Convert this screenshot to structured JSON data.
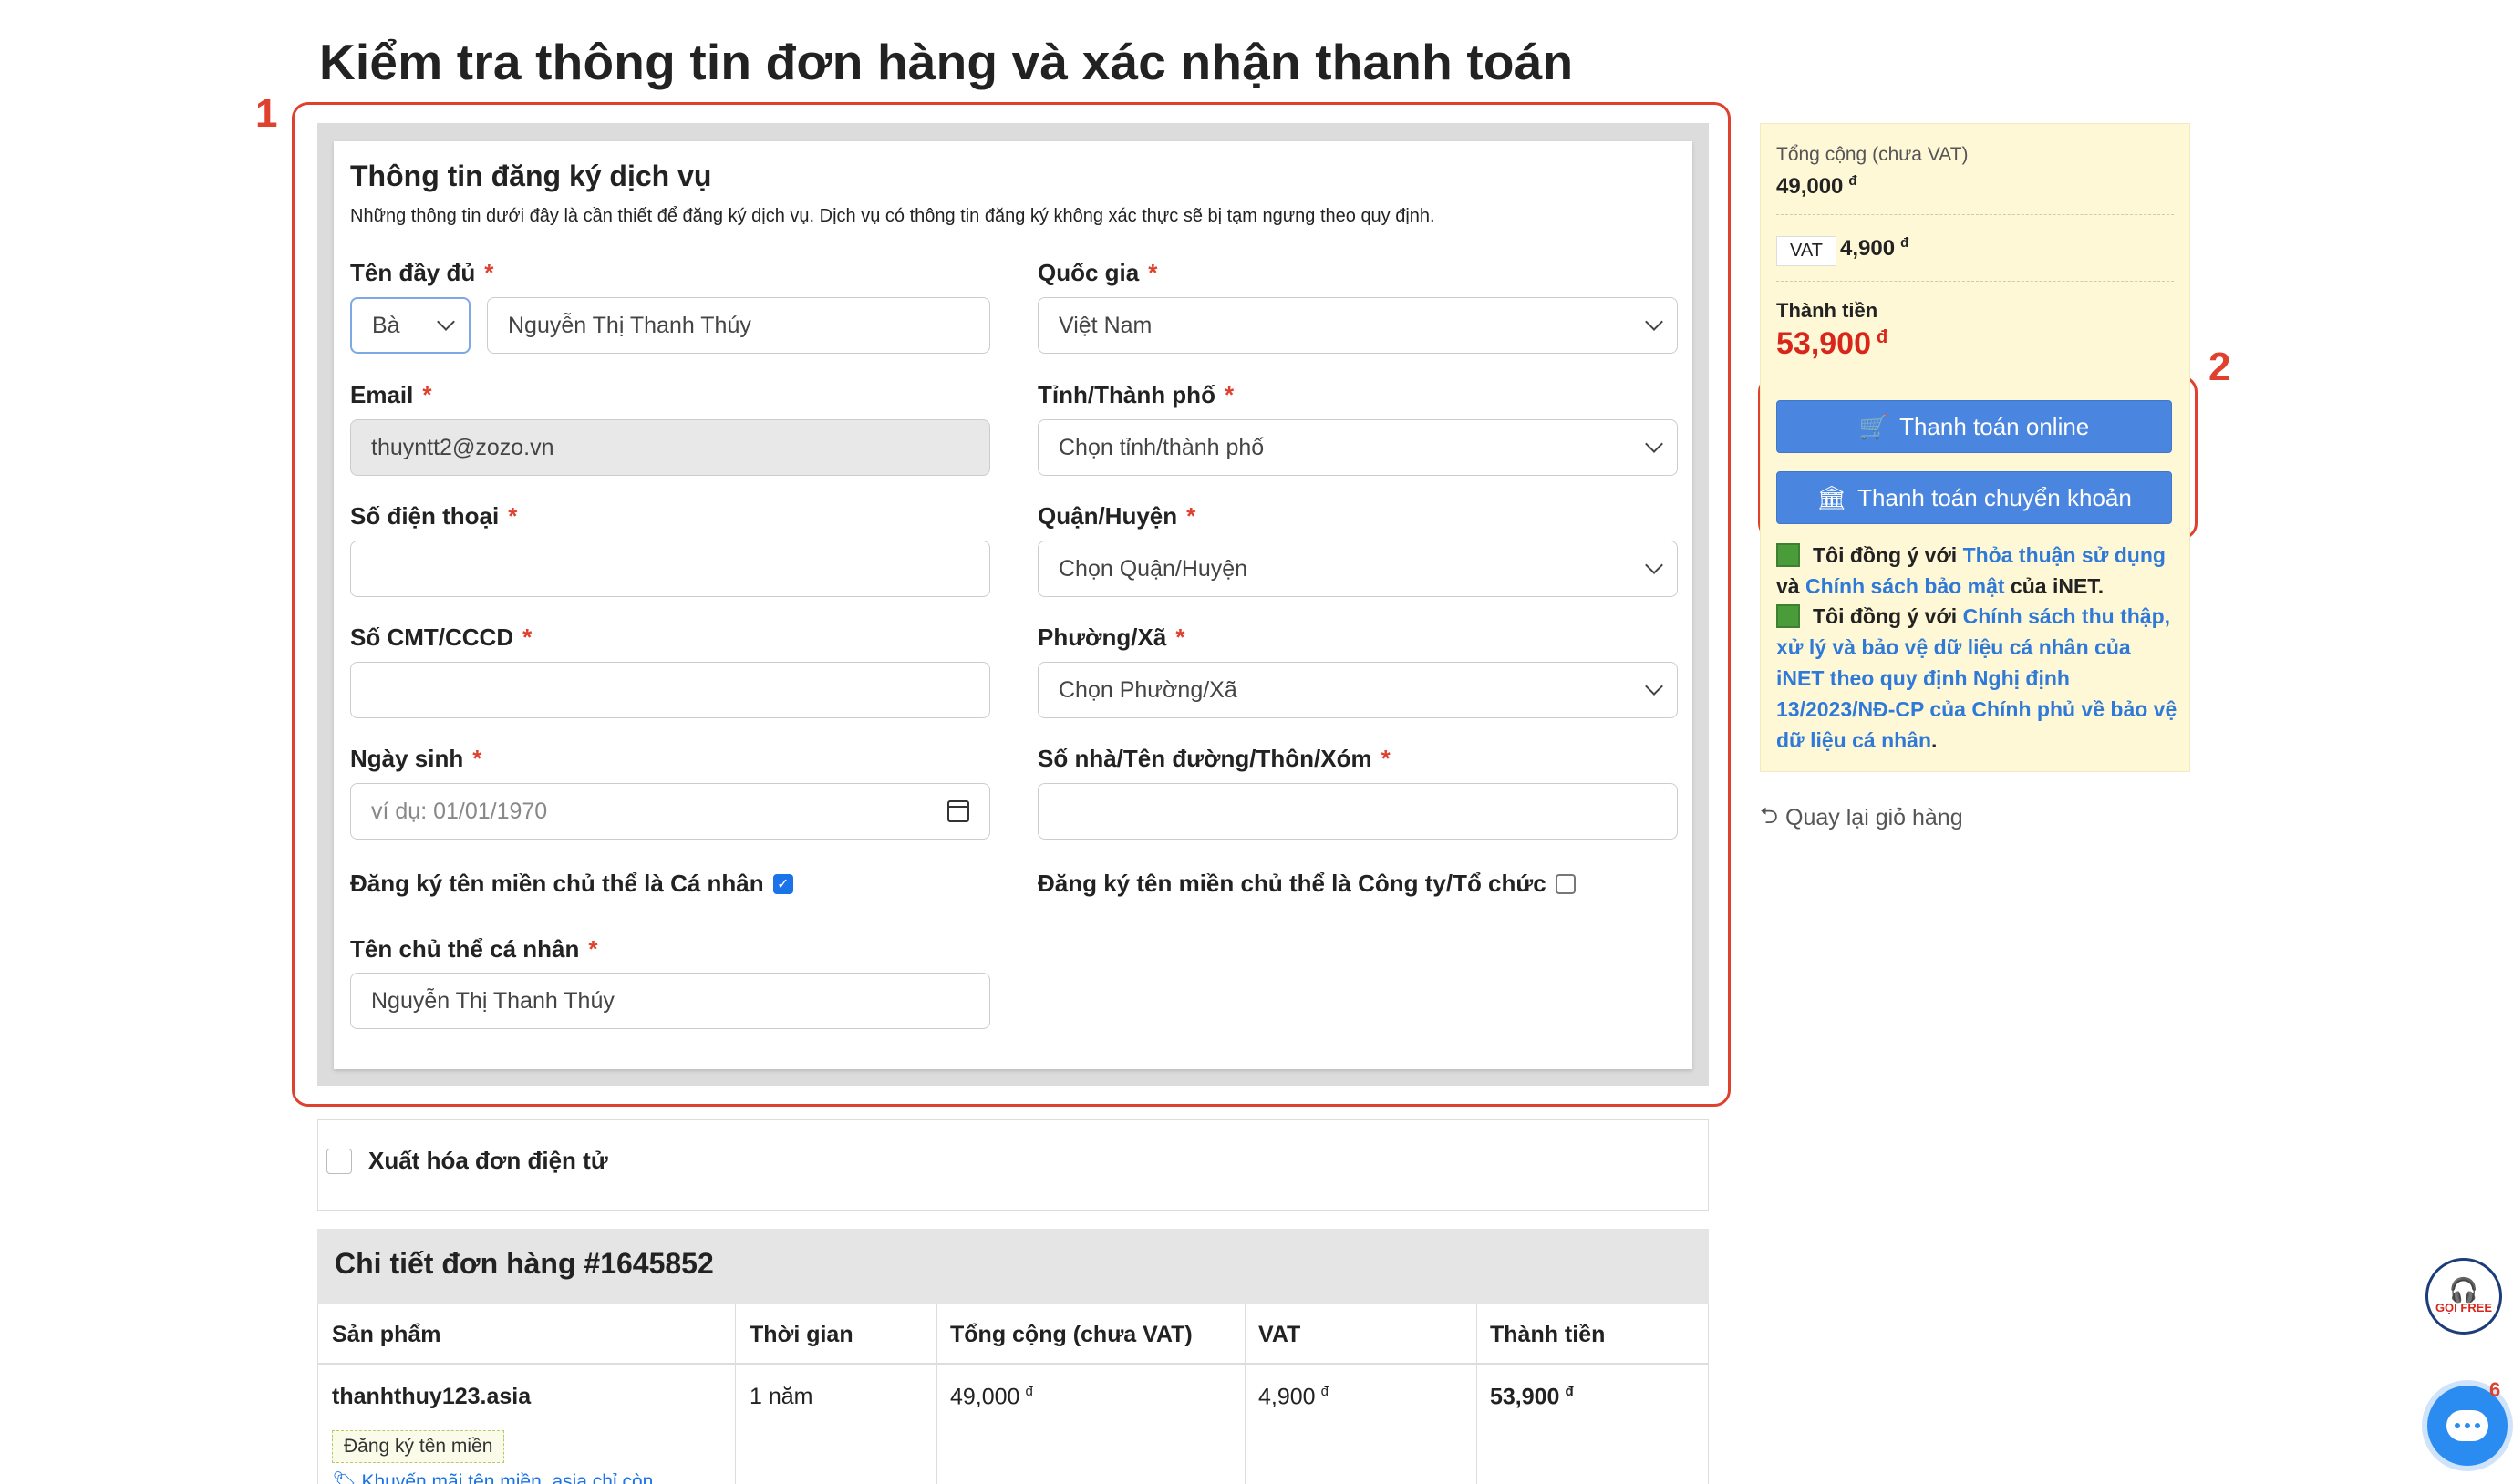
{
  "page_title": "Kiểm tra thông tin đơn hàng và xác nhận thanh toán",
  "steps": {
    "one": "1",
    "two": "2"
  },
  "registration": {
    "title": "Thông tin đăng ký dịch vụ",
    "description": "Những thông tin dưới đây là cần thiết để đăng ký dịch vụ. Dịch vụ có thông tin đăng ký không xác thực sẽ bị tạm ngưng theo quy định.",
    "required_mark": "*",
    "full_name": {
      "label": "Tên đầy đủ",
      "salutation": "Bà",
      "value": "Nguyễn Thị Thanh Thúy"
    },
    "country": {
      "label": "Quốc gia",
      "value": "Việt Nam"
    },
    "email": {
      "label": "Email",
      "value": "thuyntt2@zozo.vn"
    },
    "province": {
      "label": "Tỉnh/Thành phố",
      "value": "Chọn tỉnh/thành phố"
    },
    "phone": {
      "label": "Số điện thoại",
      "value": ""
    },
    "district": {
      "label": "Quận/Huyện",
      "value": "Chọn Quận/Huyện"
    },
    "id_number": {
      "label": "Số CMT/CCCD",
      "value": ""
    },
    "ward": {
      "label": "Phường/Xã",
      "value": "Chọn Phường/Xã"
    },
    "birthday": {
      "label": "Ngày sinh",
      "placeholder": "ví dụ: 01/01/1970"
    },
    "address": {
      "label": "Số nhà/Tên đường/Thôn/Xóm",
      "value": ""
    },
    "register_personal": {
      "label": "Đăng ký tên miền chủ thể là Cá nhân",
      "checked": true
    },
    "register_company": {
      "label": "Đăng ký tên miền chủ thể là Công ty/Tổ chức",
      "checked": false
    },
    "owner_name": {
      "label": "Tên chủ thể cá nhân",
      "value": "Nguyễn Thị Thanh Thúy"
    }
  },
  "invoice": {
    "label": "Xuất hóa đơn điện tử",
    "checked": false
  },
  "order": {
    "title": "Chi tiết đơn hàng #1645852",
    "columns": [
      "Sản phẩm",
      "Thời gian",
      "Tổng cộng (chưa VAT)",
      "VAT",
      "Thành tiền"
    ],
    "rows": [
      {
        "product": "thanhthuy123.asia",
        "duration": "1 năm",
        "subtotal": "49,000",
        "vat": "4,900",
        "total": "53,900",
        "tag": "Đăng ký tên miền",
        "promo": "Khuyến mãi tên miền .asia chỉ còn"
      }
    ],
    "currency": "đ"
  },
  "summary": {
    "subtotal_label": "Tổng cộng (chưa VAT)",
    "subtotal_value": "49,000",
    "vat_label": "VAT",
    "vat_value": "4,900",
    "total_label": "Thành tiền",
    "total_value": "53,900",
    "currency": "đ",
    "pay_online": "Thanh toán online",
    "pay_transfer": "Thanh toán chuyển khoản",
    "agree1_prefix": "Tôi đồng ý với",
    "agree1_link1": "Thỏa thuận sử dụng",
    "agree1_and": "và",
    "agree1_link2": "Chính sách bảo mật",
    "agree1_suffix": "của iNET.",
    "agree2_prefix": "Tôi đồng ý với",
    "agree2_link": "Chính sách thu thập, xử lý và bảo vệ dữ liệu cá nhân của iNET theo quy định Nghị định 13/2023/NĐ-CP của Chính phủ về bảo vệ dữ liệu cá nhân",
    "agree2_suffix": ".",
    "back_link": "Quay lại giỏ hàng"
  },
  "widgets": {
    "hotline_text": "GỌI FREE",
    "chat_badge": "6"
  },
  "colors": {
    "accent_red": "#e0402e",
    "button_blue": "#4a86e0",
    "link_blue": "#2f7ad8",
    "total_red": "#d8261c",
    "summary_bg": "#fff8d6"
  }
}
